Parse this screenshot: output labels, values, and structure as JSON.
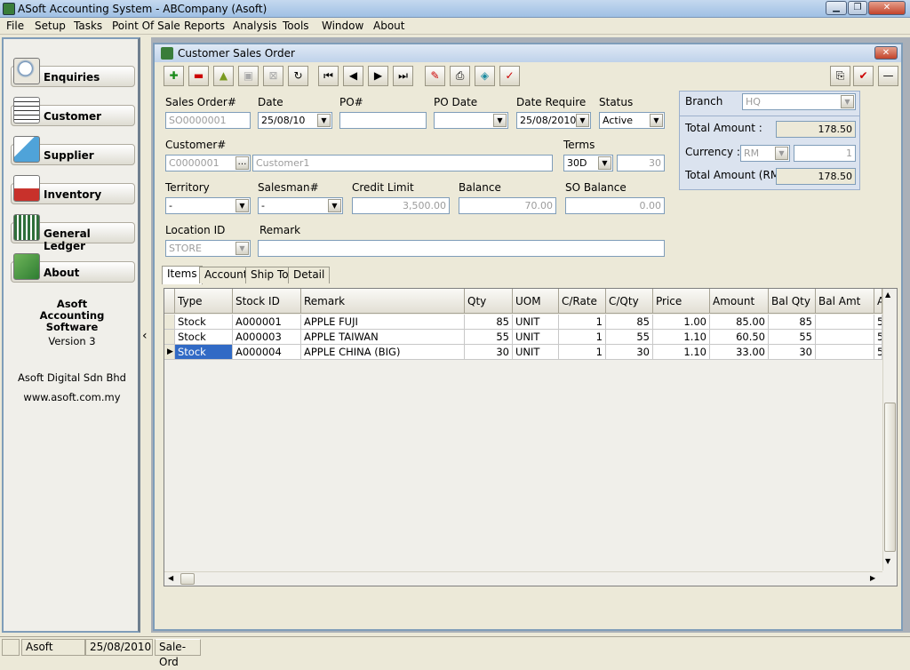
{
  "app": {
    "title": "ASoft Accounting System - ABCompany (Asoft)"
  },
  "menu": [
    "File",
    "Setup",
    "Tasks",
    "Point Of Sale",
    "Reports",
    "Analysis",
    "Tools",
    "Window",
    "About"
  ],
  "sidebar": {
    "items": [
      {
        "label": "Enquiries",
        "icon": "magnifier-icon"
      },
      {
        "label": "Customer",
        "icon": "received-stamp-icon"
      },
      {
        "label": "Supplier",
        "icon": "supplier-box-icon"
      },
      {
        "label": "Inventory",
        "icon": "truck-icon"
      },
      {
        "label": "General Ledger",
        "icon": "ledger-book-icon"
      },
      {
        "label": "About",
        "icon": "money-icon"
      }
    ],
    "about_product": "Asoft Accounting Software",
    "version": "Version 3",
    "company": "Asoft Digital Sdn Bhd",
    "website": "www.asoft.com.my"
  },
  "splitter": {
    "glyph": "‹"
  },
  "window": {
    "title": "Customer Sales Order"
  },
  "form": {
    "sales_order_label": "Sales Order#",
    "sales_order": "SO0000001",
    "date_label": "Date",
    "date": "25/08/10",
    "po_label": "PO#",
    "po": "",
    "po_date_label": "PO Date",
    "po_date": "",
    "date_require_label": "Date Require",
    "date_require": "25/08/2010",
    "status_label": "Status",
    "status": "Active",
    "customer_label": "Customer#",
    "customer_code": "C0000001",
    "customer_name": "Customer1",
    "terms_label": "Terms",
    "terms": "30D",
    "terms_days": "30",
    "territory_label": "Territory",
    "territory": "-",
    "salesman_label": "Salesman#",
    "salesman": "-",
    "credit_limit_label": "Credit Limit",
    "credit_limit": "3,500.00",
    "balance_label": "Balance",
    "balance": "70.00",
    "so_balance_label": "SO Balance",
    "so_balance": "0.00",
    "location_label": "Location ID",
    "location": "STORE",
    "remark_label": "Remark",
    "remark": ""
  },
  "summary": {
    "branch_label": "Branch",
    "branch": "HQ",
    "total_label": "Total Amount :",
    "total": "178.50",
    "currency_label": "Currency :",
    "currency": "RM",
    "rate": "1",
    "total_rm_label": "Total Amount (RM)",
    "total_rm": "178.50"
  },
  "tabs": [
    "Items",
    "Account",
    "Ship To",
    "Detail"
  ],
  "grid": {
    "columns": [
      "Type",
      "Stock ID",
      "Remark",
      "Qty",
      "UOM",
      "C/Rate",
      "C/Qty",
      "Price",
      "Amount",
      "Bal Qty",
      "Bal Amt",
      "A"
    ],
    "rows": [
      [
        "Stock",
        "A000001",
        "APPLE FUJI",
        "85",
        "UNIT",
        "1",
        "85",
        "1.00",
        "85.00",
        "85",
        "",
        "5"
      ],
      [
        "Stock",
        "A000003",
        "APPLE TAIWAN",
        "55",
        "UNIT",
        "1",
        "55",
        "1.10",
        "60.50",
        "55",
        "",
        "5"
      ],
      [
        "Stock",
        "A000004",
        "APPLE CHINA (BIG)",
        "30",
        "UNIT",
        "1",
        "30",
        "1.10",
        "33.00",
        "30",
        "",
        "5"
      ]
    ]
  },
  "status": {
    "user": "Asoft",
    "date": "25/08/2010",
    "module": "Sale-Ord"
  }
}
